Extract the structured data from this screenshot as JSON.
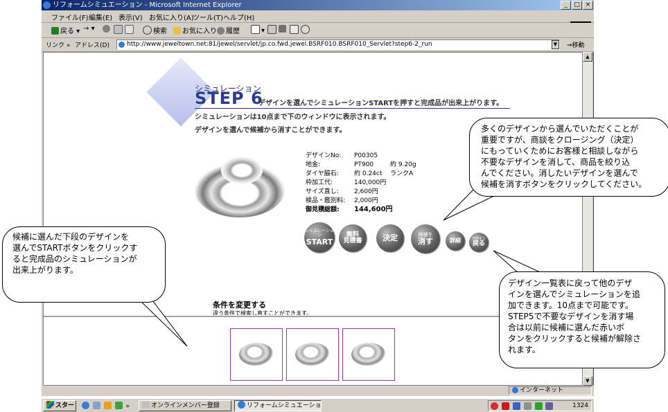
{
  "window": {
    "title": "リフォームシミュエーション - Microsoft Internet Explorer"
  },
  "menu": [
    "ファイル(F)",
    "編集(E)",
    "表示(V)",
    "お気に入り(A)",
    "ツール(T)",
    "ヘルプ(H)"
  ],
  "toolbar": {
    "back": "戻る",
    "forward": "→",
    "search": "検索",
    "favorites": "お気に入り",
    "history": "履歴"
  },
  "address": {
    "links_label": "リンク",
    "links_chevron": "»",
    "address_label": "アドレス(D)",
    "url": "http://www.jeweltown.net:81/jewel/servlet/jp.co.fwd.jewel.BSRF010.BSRF010_Servlet?step6-2_run",
    "go": "移動"
  },
  "page": {
    "sub_heading": "シミュレーション",
    "step_title": "STEP 6",
    "step_desc": "デザインを選んでシミュレーションSTARTを押すと完成品が出来上がります。",
    "line1": "シミュレーションは10点まで下のウィンドウに表示されます。",
    "line2": "デザインを選んで候補から消すことができます。",
    "specs": [
      {
        "label": "デザインNo:",
        "value": "P00305",
        "extra": ""
      },
      {
        "label": "地金:",
        "value": "PT900",
        "extra": "約 9.20g"
      },
      {
        "label": "ダイヤ脇石:",
        "value": "約 0.24ct",
        "extra": "ランクA"
      },
      {
        "label": "枠加工代:",
        "value": "140,000円",
        "extra": ""
      },
      {
        "label": "サイズ直し:",
        "value": "2,600円",
        "extra": ""
      },
      {
        "label": "検品・鑑別料:",
        "value": "2,000円",
        "extra": ""
      },
      {
        "label": "御見積総額:",
        "value": "144,600円",
        "extra": ""
      }
    ],
    "buttons": {
      "start_top": "シミュレーション",
      "start_main": "START",
      "free_line1": "無料",
      "free_line2": "見積書",
      "decide": "決定",
      "delete_line1": "候補を",
      "delete_line2": "消す",
      "detail": "詳細",
      "back_top": "デザイン",
      "back_main": "戻る"
    },
    "condition_title": "条件を変更する",
    "condition_desc": "違う条件で検索し直すことができます。"
  },
  "callouts": {
    "top_right": [
      "多くのデザインから選んでいただくことが",
      "重要ですが、商談をクロージング（決定）",
      "にもっていくためにお客様と相談しながら",
      "不要なデザインを消して、商品を絞り込",
      "んでください。消したいデザインを選んで",
      "候補を消すボタンをクリックしてください。"
    ],
    "left": [
      "候補に選んだ下段のデザインを",
      "選んでSTARTボタンをクリックす",
      "ると完成品のシミュレーションが",
      "出来上がります。"
    ],
    "bottom_right": [
      "デザイン一覧表に戻って他のデザ",
      "インを選んでシミュレーションを追",
      "加できます。10点まで可能です。",
      "STEP5で不要なデザインを消す場",
      "合は以前に候補に選んだ赤いボ",
      "タンをクリックすると候補が解除さ",
      "れます。"
    ]
  },
  "statusbar": {
    "zone": "インターネット"
  },
  "taskbar": {
    "start": "スタート",
    "chevron": "»",
    "task1": "オンラインメンバー登録",
    "task2": "リフォームシミュエーション...",
    "clock": "1324"
  }
}
